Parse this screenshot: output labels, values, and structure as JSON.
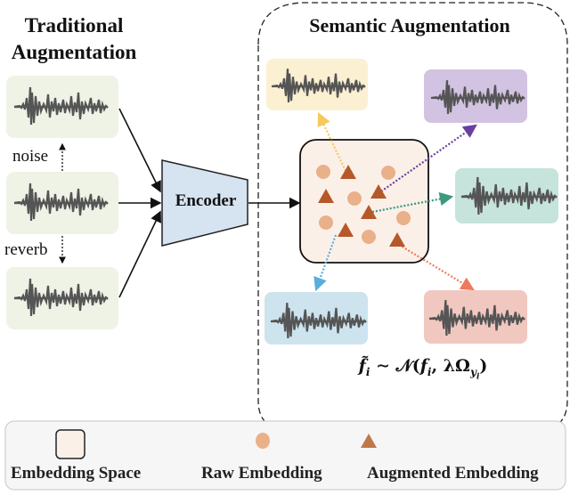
{
  "traditional": {
    "title_line1": "Traditional",
    "title_line2": "Augmentation",
    "noise_label": "noise",
    "reverb_label": "reverb",
    "panel_color": "#eef3e6"
  },
  "encoder": {
    "label": "Encoder",
    "fill": "#d6e3f0"
  },
  "semantic": {
    "title": "Semantic Augmentation",
    "embedding_space_fill": "#fbf0e8",
    "raw_color": "#e9b08a",
    "augmented_color": "#b5592a",
    "outputs": [
      {
        "name": "yellow",
        "color": "#fbf0d2",
        "arrow": "#f5c95a"
      },
      {
        "name": "purple",
        "color": "#d2c3e2",
        "arrow": "#6a3fa0"
      },
      {
        "name": "teal",
        "color": "#c6e3dc",
        "arrow": "#3c9a7e"
      },
      {
        "name": "blue",
        "color": "#cde4ef",
        "arrow": "#5aaedc"
      },
      {
        "name": "red",
        "color": "#f1c8c0",
        "arrow": "#ec7a5e"
      }
    ],
    "formula": "f̃ᵢ ∼ 𝒩(fᵢ, λΩ_yᵢ)"
  },
  "legend": {
    "items": [
      {
        "label": "Embedding Space"
      },
      {
        "label": "Raw Embedding"
      },
      {
        "label": "Augmented Embedding"
      }
    ]
  }
}
